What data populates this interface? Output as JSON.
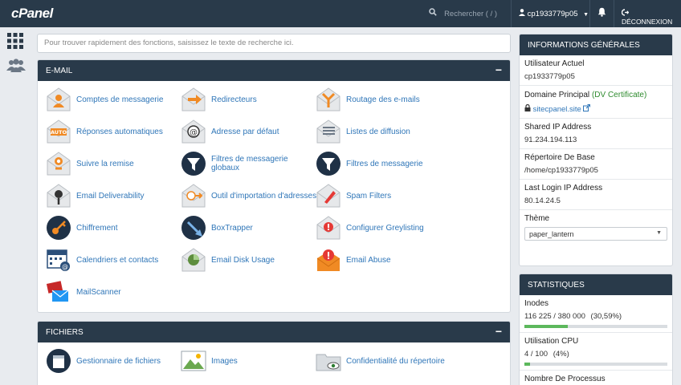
{
  "topbar": {
    "logo": "cPanel",
    "search_placeholder": "Rechercher ( / )",
    "user": "cp1933779p05",
    "logout": "DÉCONNEXION"
  },
  "search": {
    "placeholder": "Pour trouver rapidement des fonctions, saisissez le texte de recherche ici."
  },
  "email": {
    "title": "E-MAIL",
    "items": [
      {
        "label": "Comptes de messagerie",
        "icon": "email-accounts-icon"
      },
      {
        "label": "Redirecteurs",
        "icon": "forwarders-icon"
      },
      {
        "label": "Routage des e-mails",
        "icon": "email-routing-icon"
      },
      {
        "label": "Réponses automatiques",
        "icon": "autoresponders-icon"
      },
      {
        "label": "Adresse par défaut",
        "icon": "default-address-icon"
      },
      {
        "label": "Listes de diffusion",
        "icon": "mailing-lists-icon"
      },
      {
        "label": "Suivre la remise",
        "icon": "track-delivery-icon"
      },
      {
        "label": "Filtres de messagerie globaux",
        "icon": "global-filters-icon"
      },
      {
        "label": "Filtres de messagerie",
        "icon": "email-filters-icon"
      },
      {
        "label": "Email Deliverability",
        "icon": "deliverability-icon"
      },
      {
        "label": "Outil d'importation d'adresses",
        "icon": "address-importer-icon"
      },
      {
        "label": "Spam Filters",
        "icon": "spam-filters-icon"
      },
      {
        "label": "Chiffrement",
        "icon": "encryption-icon"
      },
      {
        "label": "BoxTrapper",
        "icon": "boxtrapper-icon"
      },
      {
        "label": "Configurer Greylisting",
        "icon": "greylisting-icon"
      },
      {
        "label": "Calendriers et contacts",
        "icon": "calendar-icon"
      },
      {
        "label": "Email Disk Usage",
        "icon": "disk-usage-icon"
      },
      {
        "label": "Email Abuse",
        "icon": "email-abuse-icon"
      },
      {
        "label": "MailScanner",
        "icon": "mailscanner-icon"
      }
    ]
  },
  "files": {
    "title": "FICHIERS",
    "items": [
      {
        "label": "Gestionnaire de fichiers",
        "icon": "file-manager-icon"
      },
      {
        "label": "Images",
        "icon": "images-icon"
      },
      {
        "label": "Confidentialité du répertoire",
        "icon": "directory-privacy-icon"
      }
    ]
  },
  "info": {
    "title": "INFORMATIONS GÉNÉRALES",
    "current_user_label": "Utilisateur Actuel",
    "current_user": "cp1933779p05",
    "domain_label": "Domaine Principal",
    "domain_cert_open": "(",
    "domain_cert": "DV Certificate",
    "domain_cert_close": ")",
    "domain": "sitecpanel.site",
    "ip_label": "Shared IP Address",
    "ip": "91.234.194.113",
    "home_label": "Répertoire De Base",
    "home": "/home/cp1933779p05",
    "last_login_label": "Last Login IP Address",
    "last_login": "80.14.24.5",
    "theme_label": "Thème",
    "theme": "paper_lantern"
  },
  "stats": {
    "title": "STATISTIQUES",
    "inodes_label": "Inodes",
    "inodes_value": "116 225 / 380 000",
    "inodes_pct": "(30,59%)",
    "inodes_fraction": 0.3059,
    "cpu_label": "Utilisation CPU",
    "cpu_value": "4 / 100",
    "cpu_pct": "(4%)",
    "cpu_fraction": 0.04,
    "proc_label": "Nombre De Processus"
  },
  "colors": {
    "topbar": "#293a4a",
    "link": "#2f76b8",
    "accent_orange": "#f08a24",
    "progress": "#5cb85c"
  }
}
